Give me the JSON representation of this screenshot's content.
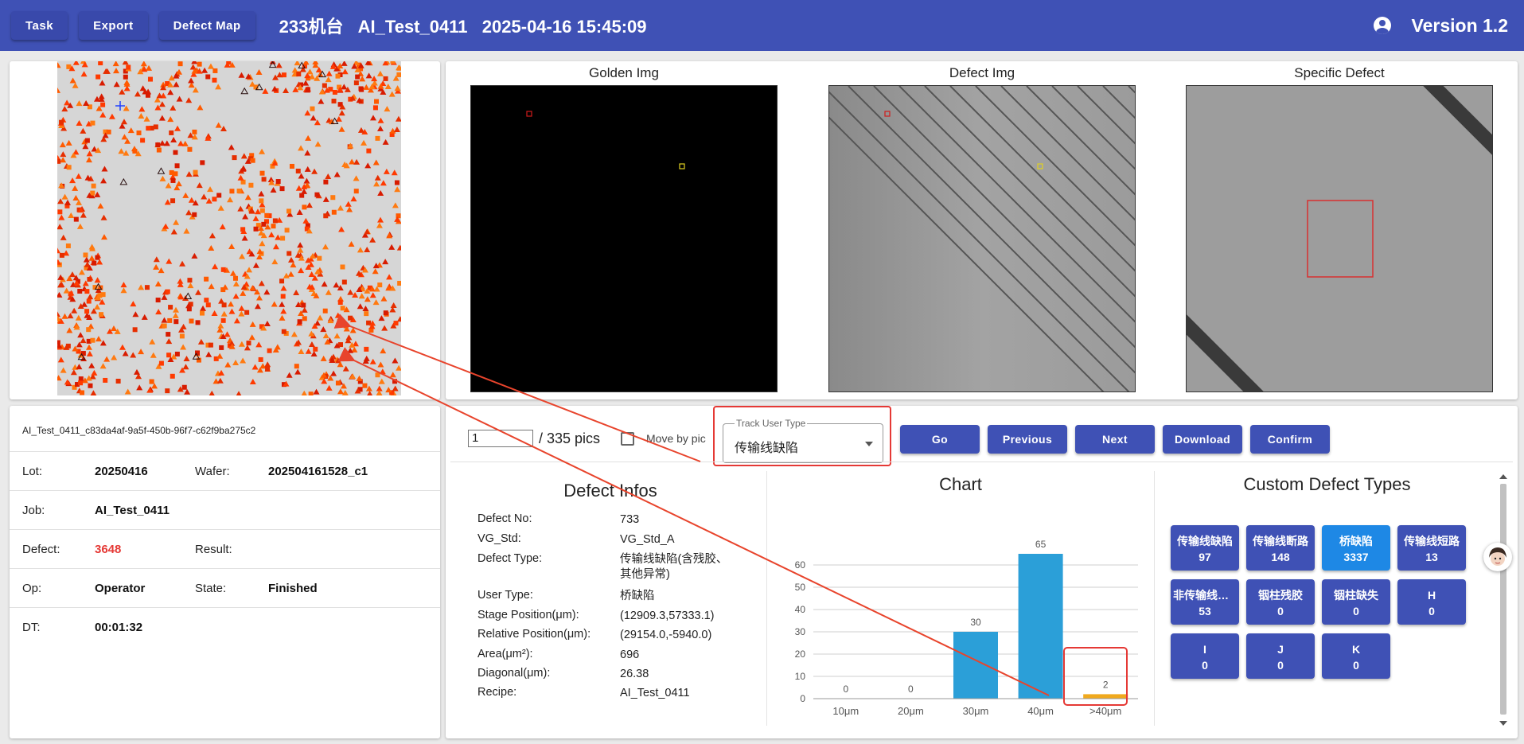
{
  "header": {
    "buttons": [
      "Task",
      "Export",
      "Defect Map"
    ],
    "title": "233机台   AI_Test_0411   2025-04-16 15:45:09",
    "version": "Version 1.2"
  },
  "images": {
    "golden_title": "Golden Img",
    "defect_title": "Defect Img",
    "specific_title": "Specific Defect"
  },
  "info": {
    "uuid": "AI_Test_0411_c83da4af-9a5f-450b-96f7-c62f9ba275c2",
    "lot_label": "Lot:",
    "lot": "20250416",
    "wafer_label": "Wafer:",
    "wafer": "202504161528_c1",
    "job_label": "Job:",
    "job": "AI_Test_0411",
    "defect_label": "Defect:",
    "defect": "3648",
    "result_label": "Result:",
    "result": "",
    "op_label": "Op:",
    "op": "Operator",
    "state_label": "State:",
    "state": "Finished",
    "dt_label": "DT:",
    "dt": "00:01:32"
  },
  "controls": {
    "page_value": "1",
    "page_total": "/ 335 pics",
    "move_by_pic_label": "Move by pic",
    "track_label": "Track User Type",
    "track_value": "传输线缺陷",
    "go": "Go",
    "previous": "Previous",
    "next": "Next",
    "download": "Download",
    "confirm": "Confirm"
  },
  "defect_infos": {
    "title": "Defect Infos",
    "rows": [
      {
        "k": "Defect No:",
        "v": "733"
      },
      {
        "k": "VG_Std:",
        "v": "VG_Std_A"
      },
      {
        "k": "Defect Type:",
        "v": "传输线缺陷(含残胶、"
      },
      {
        "k": "",
        "v": "其他异常)"
      },
      {
        "k": "User Type:",
        "v": "桥缺陷"
      },
      {
        "k": "Stage Position(μm):",
        "v": "(12909.3,57333.1)"
      },
      {
        "k": "Relative Position(μm):",
        "v": "(29154.0,-5940.0)"
      },
      {
        "k": "Area(μm²):",
        "v": "696"
      },
      {
        "k": "Diagonal(μm):",
        "v": "26.38"
      },
      {
        "k": "Recipe:",
        "v": "AI_Test_0411"
      }
    ]
  },
  "chart": {
    "title": "Chart"
  },
  "chart_data": {
    "type": "bar",
    "categories": [
      "10μm",
      "20μm",
      "30μm",
      "40μm",
      ">40μm"
    ],
    "values": [
      0,
      0,
      30,
      65,
      2
    ],
    "colors": [
      "#2b9fd8",
      "#2b9fd8",
      "#2b9fd8",
      "#2b9fd8",
      "#f0a91e"
    ],
    "title": "Chart",
    "ylim": [
      0,
      70
    ],
    "yticks": [
      0,
      10,
      20,
      30,
      40,
      50,
      60
    ],
    "grid": true
  },
  "custom_types": {
    "title": "Custom Defect Types",
    "items": [
      {
        "name": "传输线缺陷",
        "count": "97",
        "active": false
      },
      {
        "name": "传输线断路",
        "count": "148",
        "active": false
      },
      {
        "name": "桥缺陷",
        "count": "3337",
        "active": true
      },
      {
        "name": "传输线短路",
        "count": "13",
        "active": false
      },
      {
        "name": "非传输线缺陷",
        "count": "53",
        "active": false
      },
      {
        "name": "铟柱残胶",
        "count": "0",
        "active": false
      },
      {
        "name": "铟柱缺失",
        "count": "0",
        "active": false
      },
      {
        "name": "H",
        "count": "0",
        "active": false
      },
      {
        "name": "I",
        "count": "0",
        "active": false
      },
      {
        "name": "J",
        "count": "0",
        "active": false
      },
      {
        "name": "K",
        "count": "0",
        "active": false
      }
    ]
  },
  "colors": {
    "primary": "#3f51b5",
    "active": "#1e88e5",
    "highlight": "#e53935",
    "bar": "#2b9fd8",
    "bar_alt": "#f0a91e"
  }
}
